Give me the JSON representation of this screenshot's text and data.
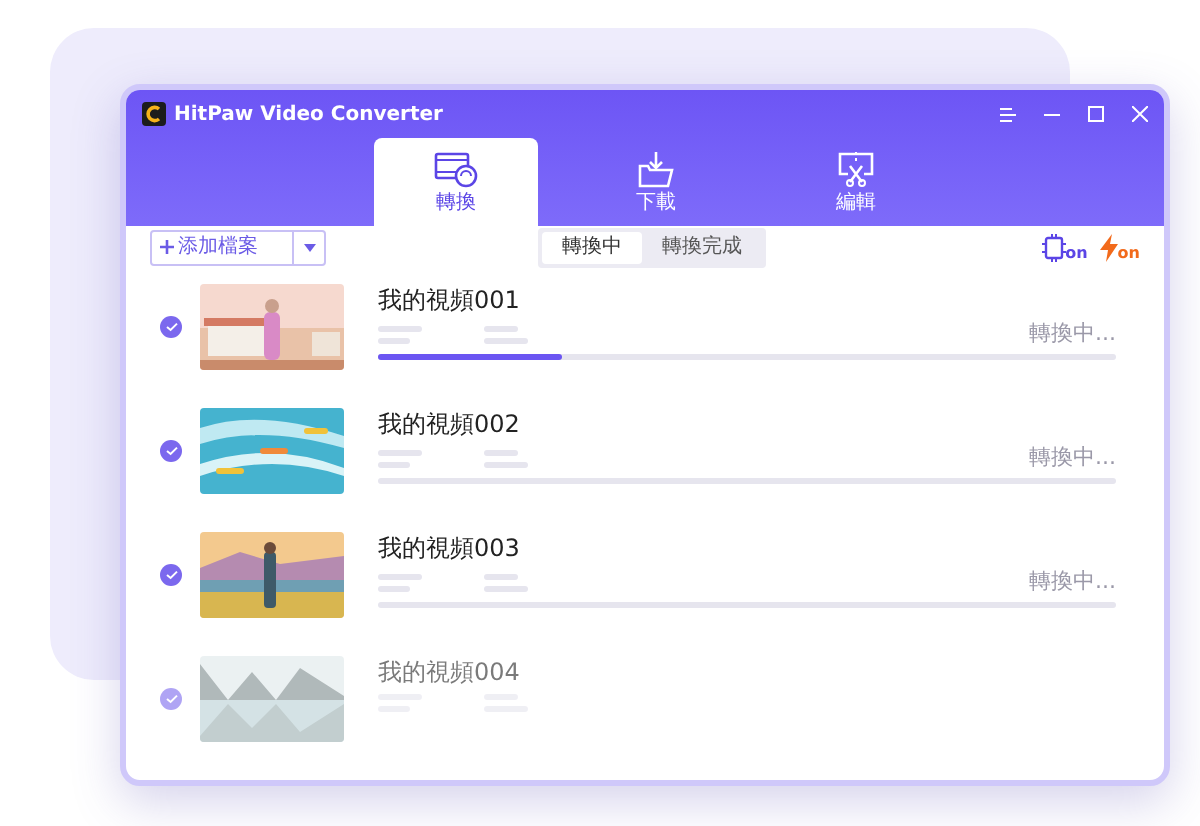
{
  "window": {
    "title": "HitPaw Video Converter"
  },
  "tabs": [
    {
      "label": "轉換",
      "selected": true,
      "kind": "convert"
    },
    {
      "label": "下載",
      "selected": false,
      "kind": "download"
    },
    {
      "label": "編輯",
      "selected": false,
      "kind": "edit"
    }
  ],
  "add_button": {
    "label": "添加檔案"
  },
  "segments": [
    {
      "label": "轉換中",
      "selected": true
    },
    {
      "label": "轉換完成",
      "selected": false
    }
  ],
  "toggles": [
    {
      "label": "on",
      "kind": "chip",
      "on": true
    },
    {
      "label": "on",
      "kind": "bolt",
      "on": true
    }
  ],
  "items": [
    {
      "title": "我的視頻001",
      "checked": true,
      "status": "轉換中...",
      "level": 0.25
    },
    {
      "title": "我的視頻002",
      "checked": true,
      "status": "轉換中...",
      "level": 0
    },
    {
      "title": "我的視頻003",
      "checked": true,
      "status": "轉換中...",
      "level": 0
    },
    {
      "title": "我的視頻004",
      "checked": true
    }
  ]
}
